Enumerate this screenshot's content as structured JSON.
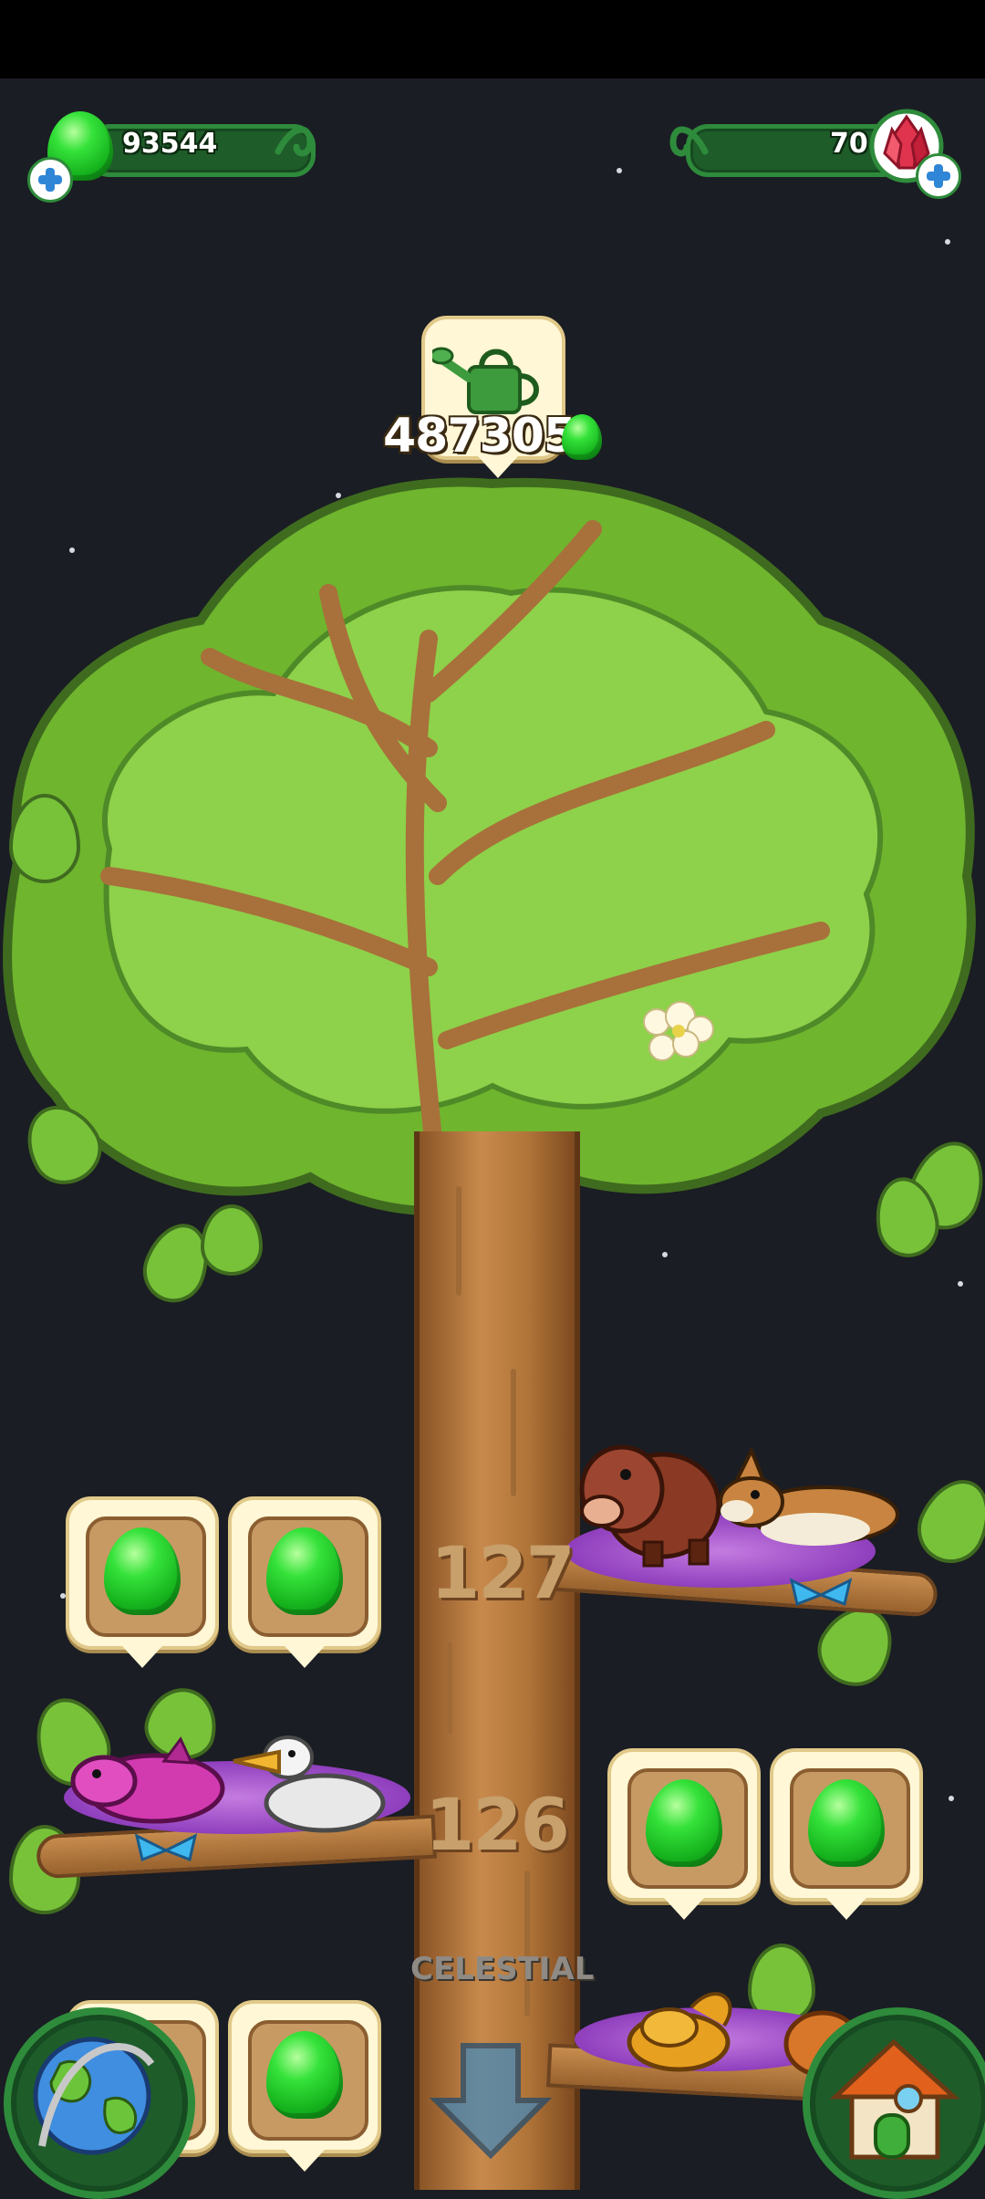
{
  "hud": {
    "gems_value": "93544",
    "crystals_value": "70"
  },
  "tree": {
    "watering_cost": "487305",
    "level_labels": [
      "127",
      "126"
    ],
    "tier_label": "CELESTIAL"
  },
  "icons": {
    "left_currency": "green-gem-icon",
    "right_currency": "red-crystal-icon",
    "watering": "watering-can-icon",
    "map": "globe-icon",
    "home": "house-icon",
    "scroll": "down-arrow-icon"
  },
  "colors": {
    "background": "#1a1d23",
    "leaf": "#78c23a",
    "trunk": "#a06a36",
    "hud_green": "#1e5c2a"
  }
}
